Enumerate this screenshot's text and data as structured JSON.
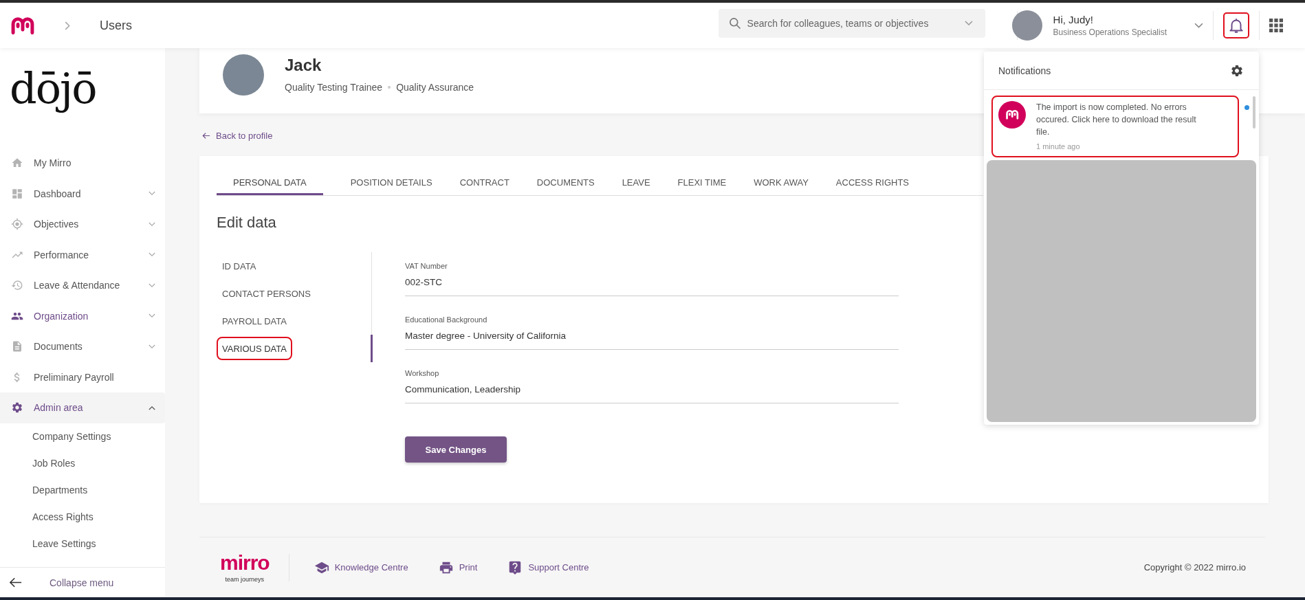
{
  "topbar": {
    "breadcrumb": "Users",
    "search": {
      "placeholder": "Search for colleagues, teams or objectives"
    },
    "user": {
      "greeting": "Hi, Judy!",
      "role": "Business Operations Specialist"
    },
    "notifications_button": {
      "highlighted": true
    }
  },
  "sidebar": {
    "logo": "dōjō",
    "items": [
      {
        "label": "My Mirro",
        "submenu": false,
        "active": false
      },
      {
        "label": "Dashboard",
        "submenu": true,
        "active": false,
        "expanded": false
      },
      {
        "label": "Objectives",
        "submenu": true,
        "active": false,
        "expanded": false
      },
      {
        "label": "Performance",
        "submenu": true,
        "active": false,
        "expanded": false
      },
      {
        "label": "Leave & Attendance",
        "submenu": true,
        "active": false,
        "expanded": false
      },
      {
        "label": "Organization",
        "submenu": true,
        "active": true,
        "expanded": false
      },
      {
        "label": "Documents",
        "submenu": true,
        "active": false,
        "expanded": false
      },
      {
        "label": "Preliminary Payroll",
        "submenu": false,
        "active": false
      },
      {
        "label": "Admin area",
        "submenu": true,
        "active": true,
        "expanded": true,
        "children": [
          "Company Settings",
          "Job Roles",
          "Departments",
          "Access Rights",
          "Leave Settings"
        ]
      }
    ],
    "collapse": "Collapse menu"
  },
  "profile": {
    "name": "Jack",
    "job": "Quality Testing Trainee",
    "department": "Quality Assurance"
  },
  "back_link": "Back to profile",
  "tabs": [
    {
      "label": "PERSONAL DATA",
      "selected": true
    },
    {
      "label": "POSITION DETAILS",
      "selected": false
    },
    {
      "label": "CONTRACT",
      "selected": false
    },
    {
      "label": "DOCUMENTS",
      "selected": false
    },
    {
      "label": "LEAVE",
      "selected": false
    },
    {
      "label": "FLEXI TIME",
      "selected": false
    },
    {
      "label": "WORK AWAY",
      "selected": false
    },
    {
      "label": "ACCESS RIGHTS",
      "selected": false
    }
  ],
  "edit_title": "Edit data",
  "sections": [
    {
      "label": "ID DATA",
      "selected": false,
      "highlighted": false
    },
    {
      "label": "CONTACT PERSONS",
      "selected": false,
      "highlighted": false
    },
    {
      "label": "PAYROLL DATA",
      "selected": false,
      "highlighted": false
    },
    {
      "label": "VARIOUS DATA",
      "selected": true,
      "highlighted": true
    }
  ],
  "fields": [
    {
      "label": "VAT Number",
      "value": "002-STC"
    },
    {
      "label": "Educational Background",
      "value": "Master degree - University of California"
    },
    {
      "label": "Workshop",
      "value": "Communication, Leadership"
    }
  ],
  "save_button": "Save Changes",
  "footer": {
    "logo": "mirro",
    "tagline": "team journeys",
    "links": [
      {
        "label": "Knowledge Centre"
      },
      {
        "label": "Print"
      },
      {
        "label": "Support Centre"
      }
    ],
    "copyright": "Copyright © 2022 mirro.io"
  },
  "notifications": {
    "title": "Notifications",
    "items": [
      {
        "text": "The import is now completed. No errors occured. Click here to download the result file.",
        "time": "1 minute ago",
        "unread": true,
        "highlighted": true
      }
    ]
  }
}
